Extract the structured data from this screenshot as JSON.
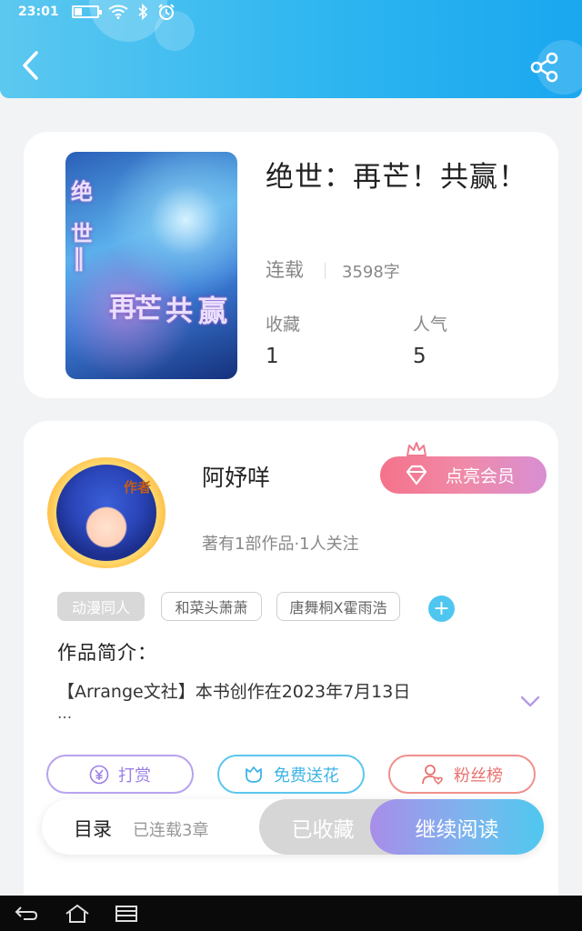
{
  "status_bar": {
    "time": "23:01"
  },
  "header": {
    "back_icon": "back-arrow-icon",
    "share_icon": "share-icon"
  },
  "book": {
    "title": "绝世：再芒！共赢！",
    "status": "连载",
    "word_count": "3598字",
    "cover_text": [
      "绝",
      "世",
      "‖",
      "再",
      "芒",
      "共",
      "赢"
    ],
    "stats": [
      {
        "label": "收藏",
        "value": "1"
      },
      {
        "label": "人气",
        "value": "5"
      }
    ]
  },
  "author": {
    "name": "阿妤咩",
    "badge": "作者",
    "meta": "著有1部作品·1人关注",
    "vip_button": "点亮会员"
  },
  "tags": [
    "动漫同人",
    "和菜头萧萧",
    "唐舞桐X霍雨浩"
  ],
  "intro": {
    "title": "作品简介：",
    "text": "【Arrange文社】本书创作在2023年7月13日",
    "ellipsis": "..."
  },
  "actions": {
    "tip": "打赏",
    "flower": "免费送花",
    "fans": "粉丝榜"
  },
  "bottom_bar": {
    "toc": "目录",
    "toc_count": "已连载3章",
    "collected": "已收藏",
    "continue": "继续阅读"
  },
  "colors": {
    "header_blue": "#2fb6f0",
    "vip_pink": "#f5728a",
    "accent_purple": "#9b7fe6",
    "accent_blue": "#3db4e6",
    "accent_red": "#e9706e"
  }
}
